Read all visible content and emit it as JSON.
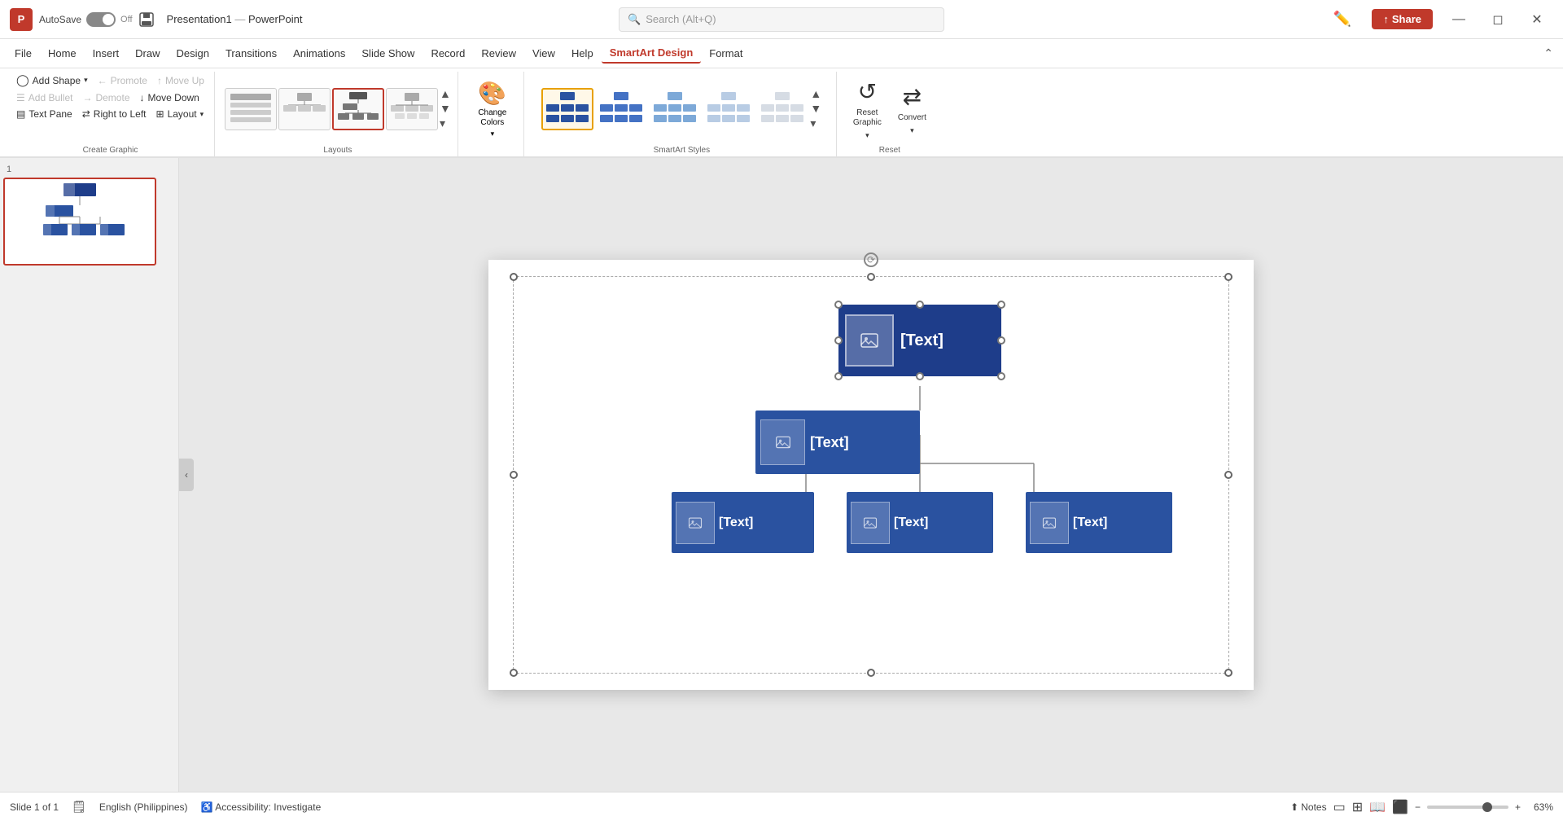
{
  "titlebar": {
    "app_icon": "P",
    "autosave_label": "AutoSave",
    "autosave_state": "Off",
    "file_name": "Presentation1",
    "separator": "—",
    "app_name": "PowerPoint",
    "search_placeholder": "Search (Alt+Q)",
    "share_label": "Share",
    "window_controls": [
      "—",
      "❐",
      "✕"
    ]
  },
  "menubar": {
    "items": [
      "File",
      "Home",
      "Insert",
      "Draw",
      "Design",
      "Transitions",
      "Animations",
      "Slide Show",
      "Record",
      "Review",
      "View",
      "Help",
      "SmartArt Design",
      "Format"
    ]
  },
  "ribbon": {
    "create_graphic": {
      "label": "Create Graphic",
      "add_shape": "Add Shape",
      "add_bullet": "Add Bullet",
      "text_pane": "Text Pane",
      "promote": "Promote",
      "demote": "Demote",
      "move_up": "Move Up",
      "move_down": "Move Down",
      "right_to_left": "Right to Left",
      "layout": "Layout"
    },
    "layouts": {
      "label": "Layouts",
      "items": [
        "list-layout",
        "hierarchy-layout",
        "selected-hierarchy-layout",
        "org-layout",
        "other-layout"
      ]
    },
    "change_colors": {
      "label": "Change\nColors"
    },
    "smartart_styles": {
      "label": "SmartArt Styles",
      "items": [
        "style-selected",
        "style-2",
        "style-3",
        "style-4",
        "style-5"
      ]
    },
    "reset": {
      "label": "Reset",
      "reset_graphic": "Reset\nGraphic",
      "convert": "Convert"
    }
  },
  "slide": {
    "number": "1",
    "total": "1"
  },
  "smartart": {
    "nodes": [
      {
        "id": "top",
        "label": "[Text]"
      },
      {
        "id": "mid",
        "label": "[Text]"
      },
      {
        "id": "bot1",
        "label": "[Text]"
      },
      {
        "id": "bot2",
        "label": "[Text]"
      },
      {
        "id": "bot3",
        "label": "[Text]"
      }
    ]
  },
  "statusbar": {
    "slide_info": "Slide 1 of 1",
    "language": "English (Philippines)",
    "accessibility": "Accessibility: Investigate",
    "notes": "Notes",
    "zoom": "63%",
    "view_icons": [
      "normal",
      "slide-sorter",
      "reading",
      "presenter"
    ]
  }
}
